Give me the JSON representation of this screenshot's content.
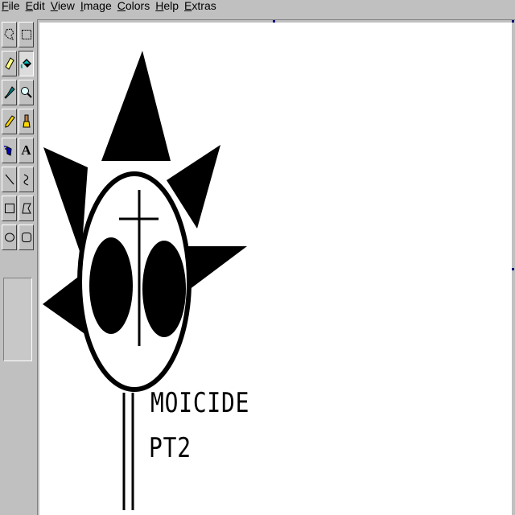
{
  "menu": {
    "items": [
      {
        "hot": "F",
        "rest": "ile"
      },
      {
        "hot": "E",
        "rest": "dit"
      },
      {
        "hot": "V",
        "rest": "iew"
      },
      {
        "hot": "I",
        "rest": "mage"
      },
      {
        "hot": "C",
        "rest": "olors"
      },
      {
        "hot": "H",
        "rest": "elp"
      },
      {
        "hot": "E",
        "rest": "xtras"
      }
    ]
  },
  "toolbox": {
    "tools": [
      "free-select-icon",
      "rect-select-icon",
      "eraser-icon",
      "fill-bucket-icon",
      "eyedropper-icon",
      "magnifier-icon",
      "pencil-icon",
      "brush-icon",
      "airbrush-icon",
      "text-icon",
      "line-icon",
      "curve-icon",
      "rectangle-icon",
      "polygon-icon",
      "ellipse-icon",
      "rounded-rect-icon"
    ],
    "selected_tool": "fill-bucket-icon",
    "text_tool_glyph": "A"
  },
  "canvas": {
    "text_line1": "MOICIDE",
    "text_line2": "PT2",
    "background": "#ffffff",
    "ink": "#000000"
  }
}
